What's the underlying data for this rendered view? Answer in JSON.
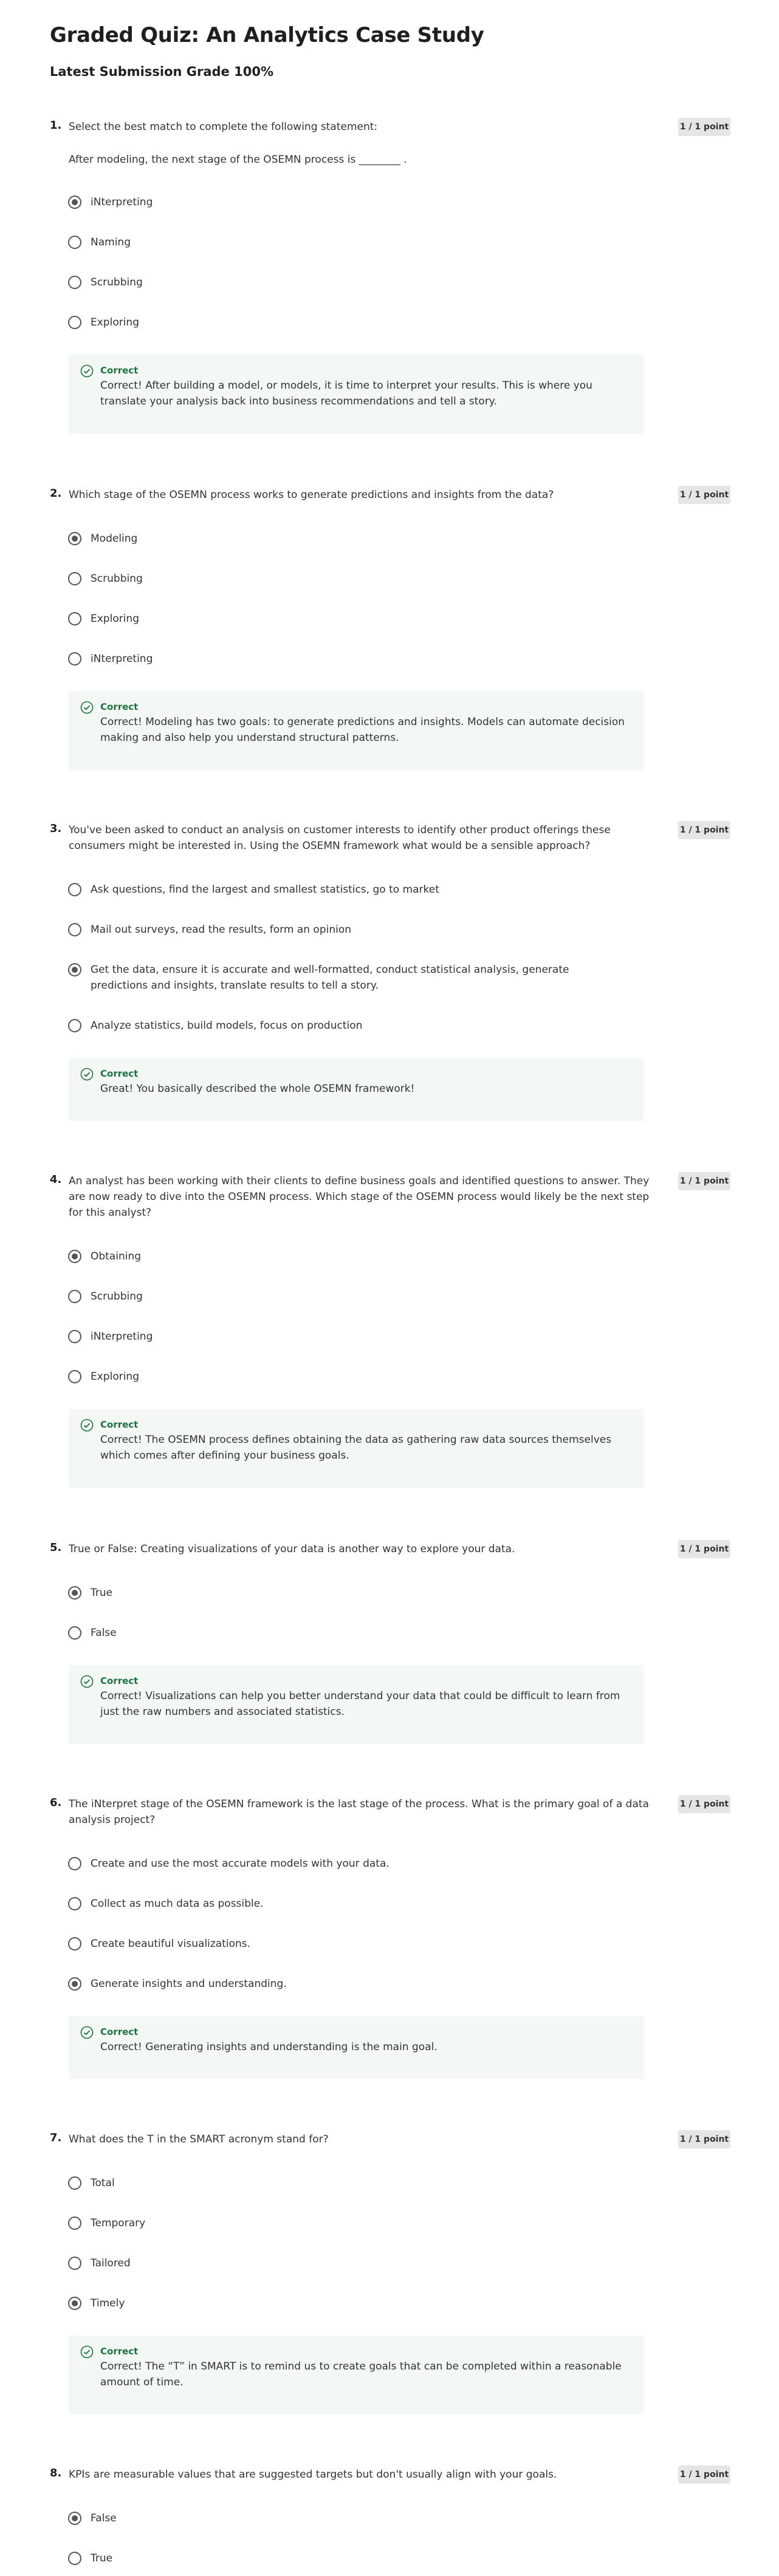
{
  "quiz": {
    "title": "Graded Quiz: An Analytics Case Study",
    "grade": "Latest Submission Grade 100%"
  },
  "questions": [
    {
      "number": "1.",
      "prompt": "Select the best match to complete the following statement:",
      "prompt2": "After modeling, the next stage of the OSEMN process is ________ .",
      "points": "1 / 1 point",
      "options": [
        {
          "label": "iNterpreting",
          "selected": true
        },
        {
          "label": "Naming",
          "selected": false
        },
        {
          "label": "Scrubbing",
          "selected": false
        },
        {
          "label": "Exploring",
          "selected": false
        }
      ],
      "feedback_title": "Correct",
      "feedback_text": "Correct! After building a model, or models, it is time to interpret your results. This is where you translate your analysis back into business recommendations and tell a story."
    },
    {
      "number": "2.",
      "prompt": "Which stage of the OSEMN process works to generate predictions and insights from the data?",
      "points": "1 / 1 point",
      "options": [
        {
          "label": "Modeling",
          "selected": true
        },
        {
          "label": "Scrubbing",
          "selected": false
        },
        {
          "label": "Exploring",
          "selected": false
        },
        {
          "label": "iNterpreting",
          "selected": false
        }
      ],
      "feedback_title": "Correct",
      "feedback_text": "Correct! Modeling has two goals: to generate predictions and insights. Models can automate decision making and also help you understand structural patterns."
    },
    {
      "number": "3.",
      "prompt": "You've been asked to conduct an analysis on customer interests to identify other product offerings these consumers might be interested in. Using the OSEMN framework what would be a sensible approach?",
      "points": "1 / 1 point",
      "options": [
        {
          "label": "Ask questions, find the largest and smallest statistics, go to market",
          "selected": false
        },
        {
          "label": "Mail out surveys, read the results, form an opinion",
          "selected": false
        },
        {
          "label": "Get the data, ensure it is accurate and well-formatted, conduct statistical analysis, generate predictions and insights, translate results to tell a story.",
          "selected": true
        },
        {
          "label": "Analyze statistics, build models, focus on production",
          "selected": false
        }
      ],
      "feedback_title": "Correct",
      "feedback_text": "Great! You basically described the whole OSEMN framework!"
    },
    {
      "number": "4.",
      "prompt": "An analyst has been working with their clients to define business goals and identified questions to answer. They are now ready to dive into the OSEMN process. Which stage of the OSEMN process would likely be the next step for this analyst?",
      "points": "1 / 1 point",
      "options": [
        {
          "label": "Obtaining",
          "selected": true
        },
        {
          "label": "Scrubbing",
          "selected": false
        },
        {
          "label": "iNterpreting",
          "selected": false
        },
        {
          "label": "Exploring",
          "selected": false
        }
      ],
      "feedback_title": "Correct",
      "feedback_text": "Correct! The OSEMN process defines obtaining the data as gathering raw data sources themselves which comes after defining your business goals."
    },
    {
      "number": "5.",
      "prompt": "True or False: Creating visualizations of your data is another way to explore your data.",
      "points": "1 / 1 point",
      "options": [
        {
          "label": "True",
          "selected": true
        },
        {
          "label": "False",
          "selected": false
        }
      ],
      "feedback_title": "Correct",
      "feedback_text": "Correct! Visualizations can help you better understand your data that could be difficult to learn from just the raw numbers and associated statistics."
    },
    {
      "number": "6.",
      "prompt": "The iNterpret stage of the OSEMN framework is the last stage of the process. What is the primary goal of a data analysis project?",
      "points": "1 / 1 point",
      "options": [
        {
          "label": "Create and use the most accurate models with your data.",
          "selected": false
        },
        {
          "label": "Collect as much data as possible.",
          "selected": false
        },
        {
          "label": "Create beautiful visualizations.",
          "selected": false
        },
        {
          "label": "Generate insights and understanding.",
          "selected": true
        }
      ],
      "feedback_title": "Correct",
      "feedback_text": "Correct! Generating insights and understanding is the main goal."
    },
    {
      "number": "7.",
      "prompt": "What does the T in the SMART acronym stand for?",
      "points": "1 / 1 point",
      "options": [
        {
          "label": "Total",
          "selected": false
        },
        {
          "label": "Temporary",
          "selected": false
        },
        {
          "label": "Tailored",
          "selected": false
        },
        {
          "label": "Timely",
          "selected": true
        }
      ],
      "feedback_title": "Correct",
      "feedback_text": "Correct! The “T” in SMART is to remind us to create goals that can be completed within a reasonable amount of time."
    },
    {
      "number": "8.",
      "prompt": "KPIs are measurable values that are suggested targets but don't usually align with your goals.",
      "points": "1 / 1 point",
      "options": [
        {
          "label": "False",
          "selected": true
        },
        {
          "label": "True",
          "selected": false
        }
      ]
    }
  ],
  "icons": {
    "feedback": "check-circle-icon",
    "accent_green": "#1e6f42",
    "feedback_bg": "#f4f8f5"
  }
}
